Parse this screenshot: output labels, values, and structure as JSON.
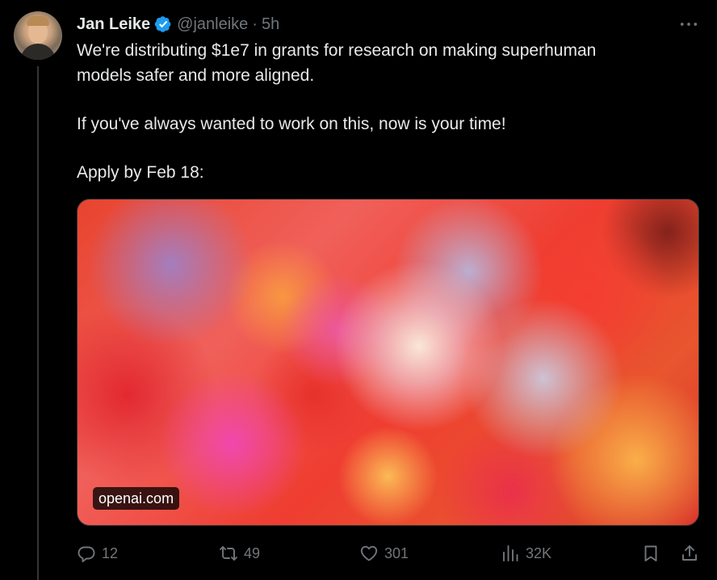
{
  "tweet": {
    "author_name": "Jan Leike",
    "handle": "@janleike",
    "separator": "·",
    "time": "5h",
    "text_lines": [
      "We're distributing $1e7 in grants for research on making superhuman",
      "models safer and more aligned.",
      "If you've always wanted to work on this, now is your time!",
      "Apply by Feb 18:"
    ],
    "link_card": {
      "domain": "openai.com"
    },
    "actions": {
      "replies": "12",
      "reposts": "49",
      "likes": "301",
      "views": "32K"
    }
  },
  "icons": {
    "verified": "verified-badge-icon",
    "more": "more-horizontal-icon",
    "reply": "reply-icon",
    "repost": "repost-icon",
    "like": "heart-icon",
    "views": "views-chart-icon",
    "bookmark": "bookmark-icon",
    "share": "share-icon"
  },
  "colors": {
    "background": "#000000",
    "text": "#e7e9ea",
    "secondary_text": "#71767b",
    "verified_blue": "#1d9bf0",
    "divider": "#333639"
  }
}
